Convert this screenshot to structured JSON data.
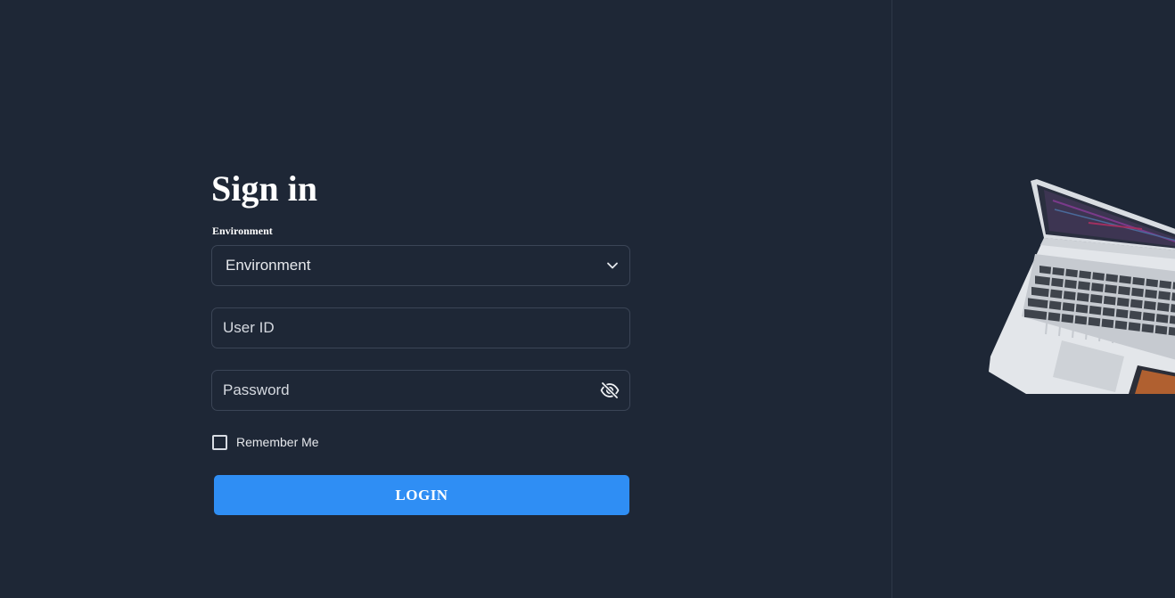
{
  "signin": {
    "title": "Sign in",
    "environment_label": "Environment",
    "environment_selected": "Environment",
    "userid_placeholder": "User ID",
    "password_placeholder": "Password",
    "remember_me": "Remember Me",
    "login_label": "LOGIN"
  },
  "colors": {
    "background": "#1e2736",
    "accent": "#2f8ef4",
    "field_border": "#3b4556"
  },
  "icons": {
    "select": "chevron-down-icon",
    "password_toggle": "eye-off-icon",
    "illustration": "laptop-illustration"
  }
}
